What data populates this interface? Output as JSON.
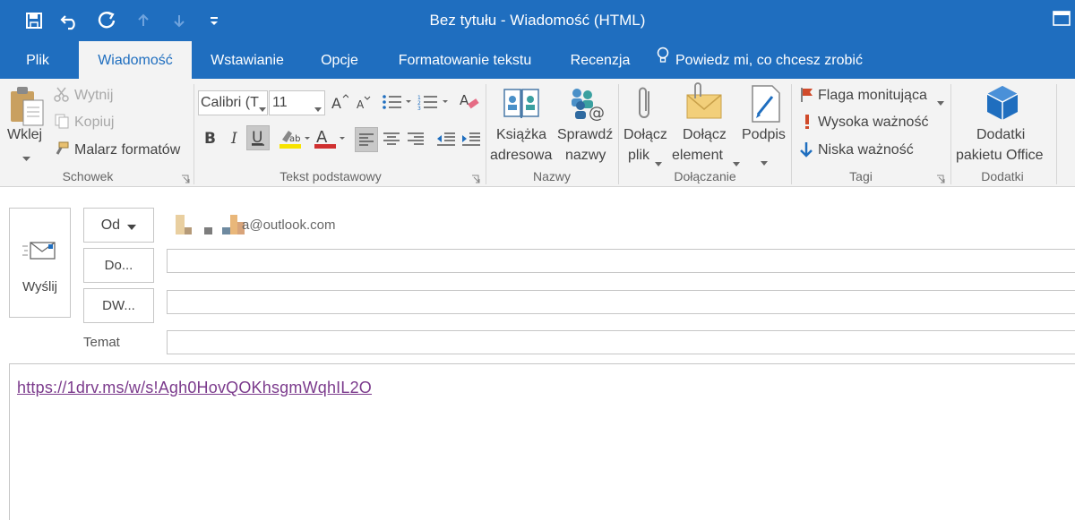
{
  "window": {
    "title": "Bez tytułu  -  Wiadomość (HTML)"
  },
  "quick_access": [
    "save-icon",
    "undo-icon",
    "redo-icon",
    "up-arrow-icon",
    "down-arrow-icon",
    "customize-qat-icon"
  ],
  "tabs": [
    {
      "label": "Plik"
    },
    {
      "label": "Wiadomość"
    },
    {
      "label": "Wstawianie"
    },
    {
      "label": "Opcje"
    },
    {
      "label": "Formatowanie tekstu"
    },
    {
      "label": "Recenzja"
    }
  ],
  "tell_me": "Powiedz mi, co chcesz zrobić",
  "ribbon": {
    "clipboard": {
      "paste": "Wklej",
      "cut": "Wytnij",
      "copy": "Kopiuj",
      "format_painter": "Malarz formatów",
      "label": "Schowek"
    },
    "basic_text": {
      "font": "Calibri (T",
      "size": "11",
      "label": "Tekst podstawowy"
    },
    "names": {
      "address_book_1": "Książka",
      "address_book_2": "adresowa",
      "check_names_1": "Sprawdź",
      "check_names_2": "nazwy",
      "label": "Nazwy"
    },
    "include": {
      "attach_file_1": "Dołącz",
      "attach_file_2": "plik",
      "attach_item_1": "Dołącz",
      "attach_item_2": "element",
      "signature": "Podpis",
      "label": "Dołączanie"
    },
    "tags": {
      "follow_up": "Flaga monitująca",
      "high_importance": "Wysoka ważność",
      "low_importance": "Niska ważność",
      "label": "Tagi"
    },
    "addins": {
      "office_addins_1": "Dodatki",
      "office_addins_2": "pakietu Office",
      "label": "Dodatki"
    }
  },
  "compose": {
    "send": "Wyślij",
    "from_button": "Od",
    "from_value": "a@outlook.com",
    "to_button": "Do...",
    "cc_button": "DW...",
    "subject_label": "Temat",
    "body_link": "https://1drv.ms/w/s!Agh0HovQOKhsgmWqhIL2O"
  },
  "colors": {
    "accent": "#1f6ebf",
    "link": "#7b3a8c",
    "highlight_yellow": "#f7e300",
    "font_red": "#d03030",
    "flag": "#d04a2a",
    "importance_high": "#d04a2a",
    "importance_low": "#1f6ebf"
  }
}
